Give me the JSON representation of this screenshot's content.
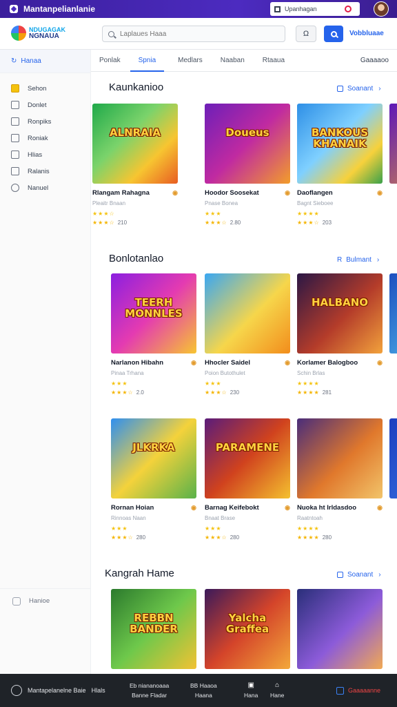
{
  "window": {
    "title": "Mantanpelianlanie",
    "chip_label": "Upanhagan"
  },
  "header": {
    "brand_line1": "NDUGAGAK",
    "brand_line2": "NGNAUA",
    "search_placeholder": "Laplaues Haaa",
    "button1_glyph": "Ω",
    "link": "Vobbluaae"
  },
  "sidebar": {
    "home_label": "Hanaa",
    "items": [
      {
        "label": "Sehon",
        "icon": "folder-icon"
      },
      {
        "label": "Donlet",
        "icon": "grid-icon"
      },
      {
        "label": "Ronpiks",
        "icon": "document-icon"
      },
      {
        "label": "Roniak",
        "icon": "square-icon"
      },
      {
        "label": "Hlias",
        "icon": "list-icon"
      },
      {
        "label": "Ralanis",
        "icon": "calendar-icon"
      },
      {
        "label": "Nanuel",
        "icon": "clock-icon"
      }
    ],
    "bottom_label": "Hanioe"
  },
  "tabs": {
    "items": [
      "Ponlak",
      "Spnia",
      "Medlars",
      "Naaban",
      "Rtaaua"
    ],
    "active_index": 1,
    "right": "Gaaaaoo"
  },
  "sections": [
    {
      "title": "Kaunkanioo",
      "link": "Soanant"
    },
    {
      "title": "Bonlotanlao",
      "link": "Bulmant"
    },
    {
      "title": "",
      "link": ""
    },
    {
      "title": "Kangrah Hame",
      "link": "Soanant"
    }
  ],
  "games": [
    {
      "title": "Rlangam Rahagna",
      "sub": "Pleaitr Bnaan",
      "stars_top": "★★★☆",
      "stars": "★★★☆",
      "rating": "210",
      "art": "ALNRAIA"
    },
    {
      "title": "Hoodor Soosekat",
      "sub": "Pnase Bonea",
      "stars_top": "★★★",
      "stars": "★★★☆",
      "rating": "2.80",
      "art": "Doueus"
    },
    {
      "title": "Daoflangen",
      "sub": "Bagnt Sieboee",
      "stars_top": "★★★★",
      "stars": "★★★☆",
      "rating": "203",
      "art": "BANKOUS KHANAIK"
    },
    {
      "title": "Narlanon Hibahn",
      "sub": "Pinaa Trhana",
      "stars_top": "★★★",
      "stars": "★★★☆",
      "rating": "2.0",
      "art": "TEERH MONNLES"
    },
    {
      "title": "Hhocler Saidel",
      "sub": "Poion Butothulet",
      "stars_top": "★★★",
      "stars": "★★★☆",
      "rating": "230",
      "art": ""
    },
    {
      "title": "Korlamer Balogboo",
      "sub": "Schin Brlas",
      "stars_top": "★★★★",
      "stars": "★★★★",
      "rating": "281",
      "art": "HALBANO"
    },
    {
      "title": "Rornan Hoian",
      "sub": "Rinnoas Naan",
      "stars_top": "★★★",
      "stars": "★★★☆",
      "rating": "280",
      "art": "JLKRKA"
    },
    {
      "title": "Barnag Keifebokt",
      "sub": "Bnaat Brase",
      "stars_top": "★★★",
      "stars": "★★★☆",
      "rating": "280",
      "art": "PARAMENE"
    },
    {
      "title": "Nuoka ht Irldasdoo",
      "sub": "Raatntoah",
      "stars_top": "★★★★",
      "stars": "★★★★",
      "rating": "280",
      "art": ""
    },
    {
      "title": "",
      "sub": "",
      "stars_top": "",
      "stars": "",
      "rating": "",
      "art": "REBBN BANDER"
    },
    {
      "title": "",
      "sub": "",
      "stars_top": "",
      "stars": "",
      "rating": "",
      "art": "Yalcha Graffea"
    },
    {
      "title": "",
      "sub": "",
      "stars_top": "",
      "stars": "",
      "rating": "",
      "art": ""
    }
  ],
  "bottombar": {
    "left": "Mantapelanelne Baie",
    "left2": "Hlals",
    "col1_top": "Eb niananoaaa",
    "col1_bottom": "Banne Fladar",
    "col2_top": "BB Haaoa",
    "col2_bottom": "Haana",
    "col3": "Hana",
    "col4": "Hane",
    "right": "Gaaaaanne"
  },
  "colors": {
    "accent": "#2563eb",
    "topbar": "#4c2bc0",
    "bottombar": "#1f2328",
    "star": "#f4b400"
  }
}
